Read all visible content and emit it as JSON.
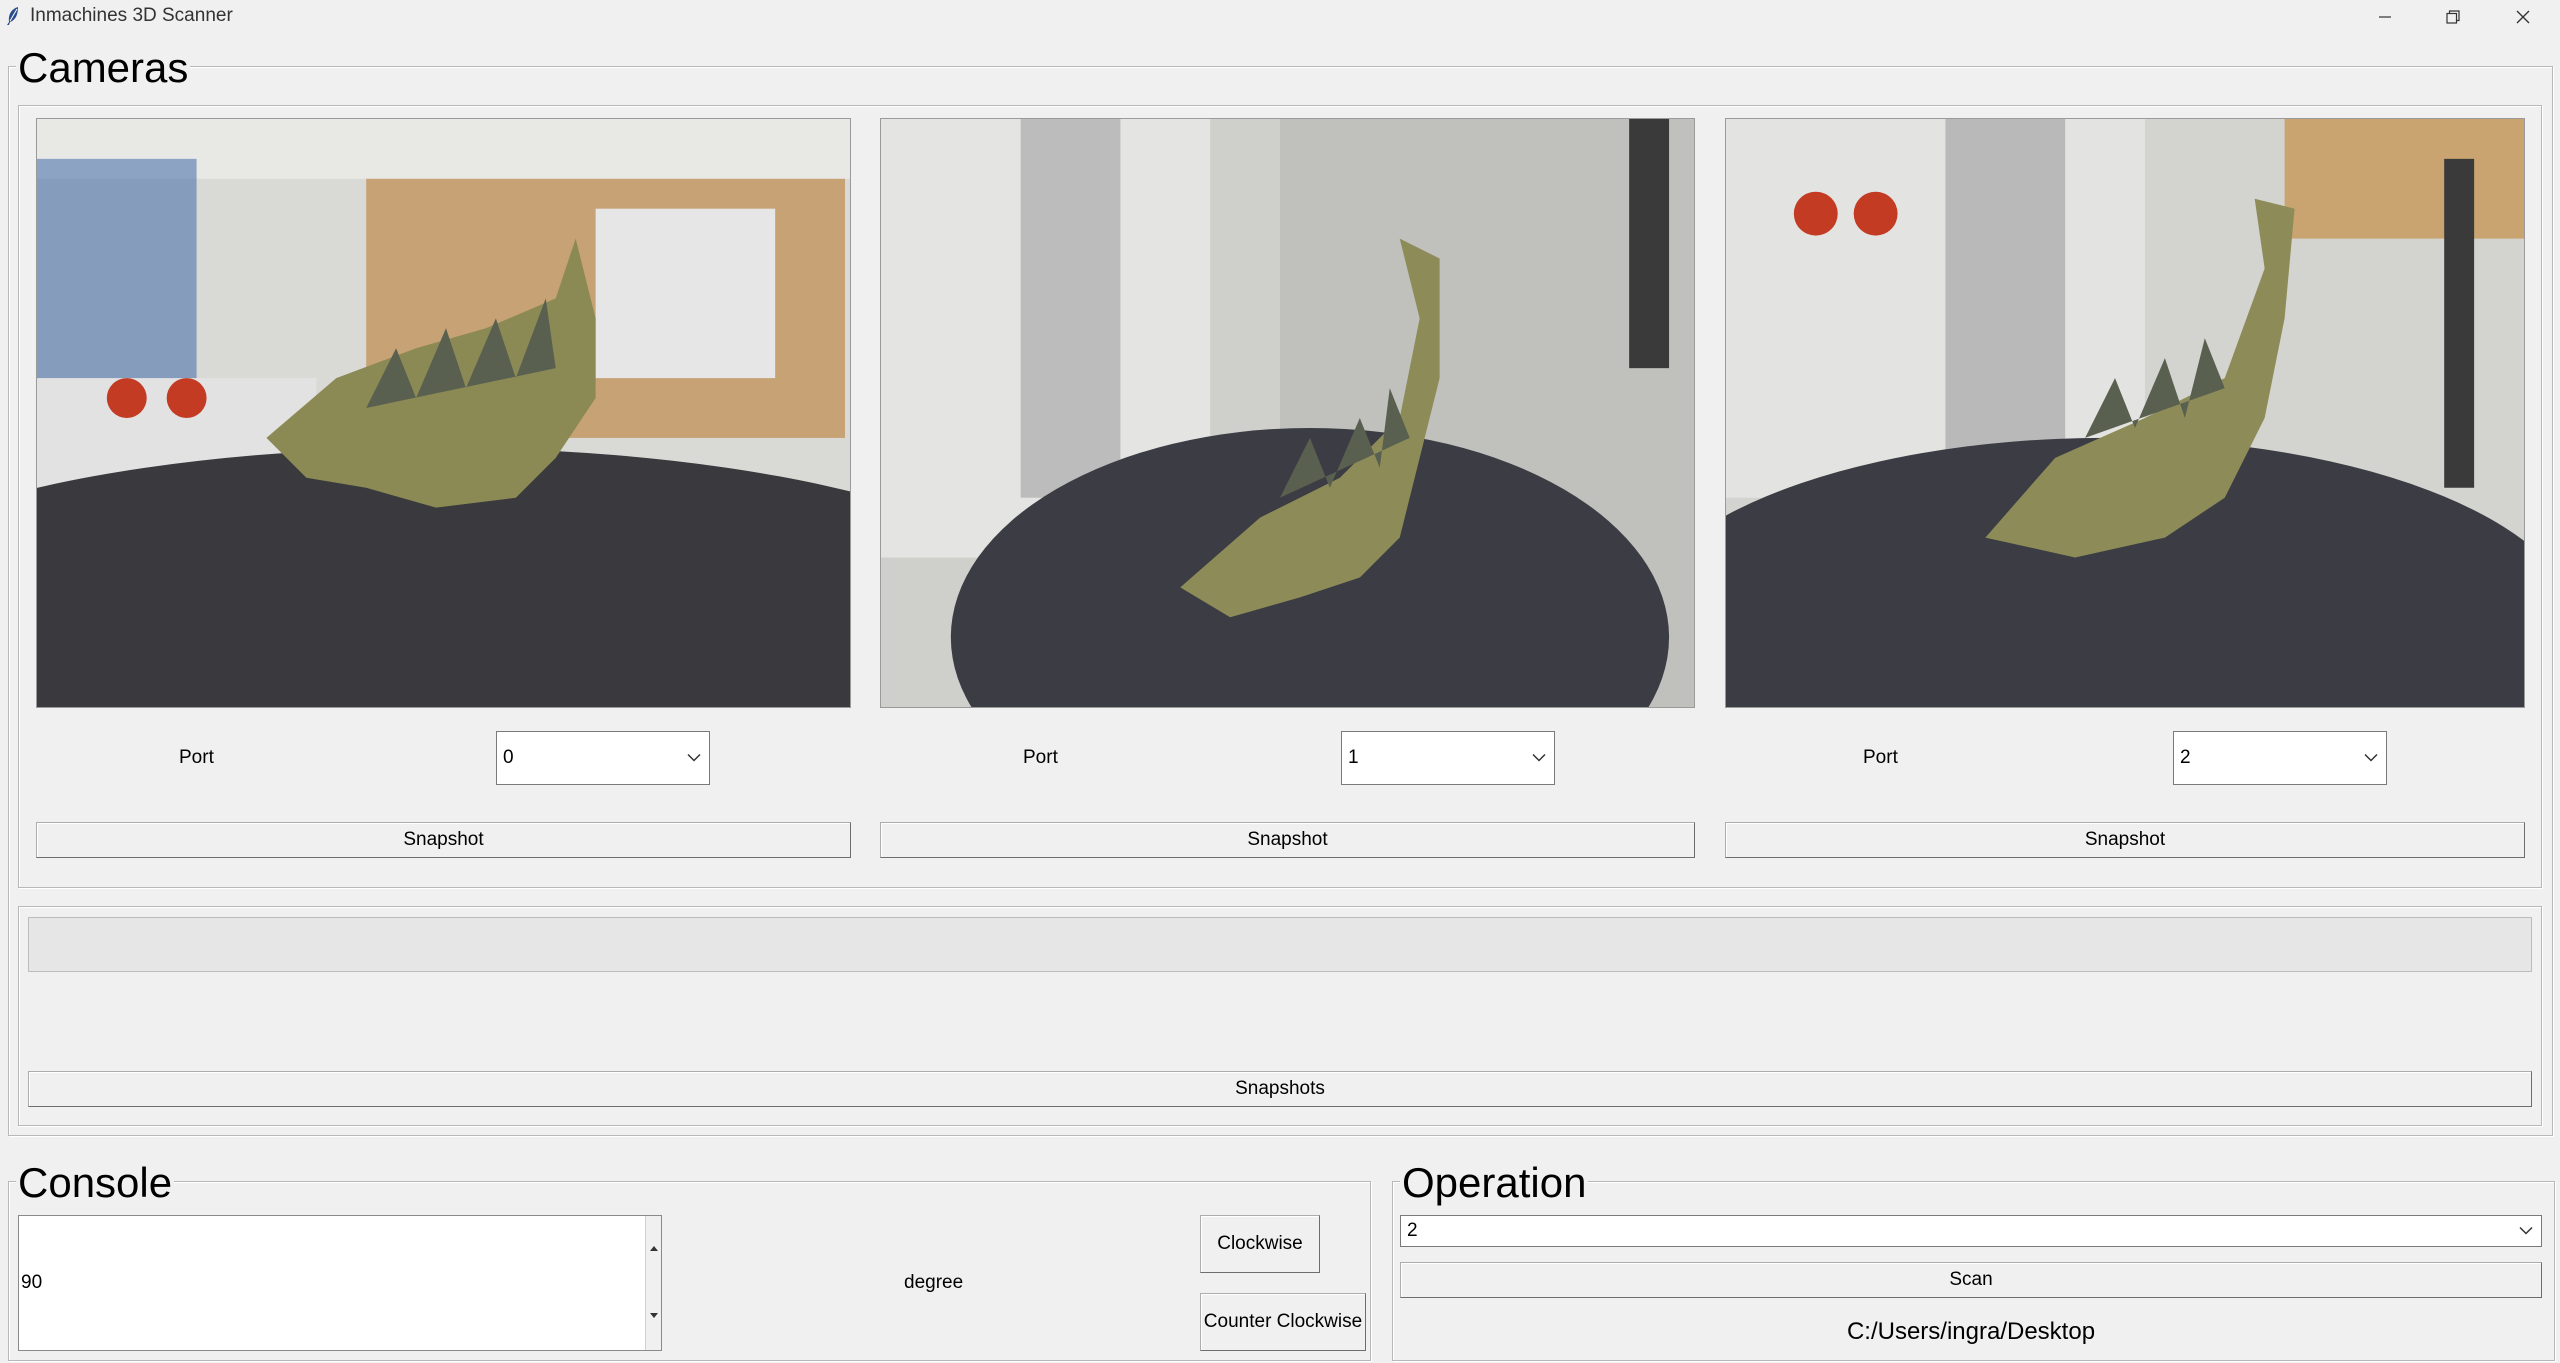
{
  "window": {
    "title": "Inmachines 3D Scanner"
  },
  "cameras": {
    "legend": "Cameras",
    "items": [
      {
        "port_label": "Port",
        "port_value": "0",
        "snapshot_label": "Snapshot"
      },
      {
        "port_label": "Port",
        "port_value": "1",
        "snapshot_label": "Snapshot"
      },
      {
        "port_label": "Port",
        "port_value": "2",
        "snapshot_label": "Snapshot"
      }
    ]
  },
  "progress": {
    "value_percent": 0
  },
  "snapshots_label": "Snapshots",
  "console": {
    "legend": "Console",
    "value": "90",
    "unit_label": "degree",
    "clockwise_label": "Clockwise",
    "counter_clockwise_label": "Counter Clockwise"
  },
  "operation": {
    "legend": "Operation",
    "selected": "2",
    "scan_label": "Scan",
    "path": "C:/Users/ingra/Desktop"
  },
  "icons": {
    "app": "feather-icon",
    "minimize": "minimize-icon",
    "restore": "restore-icon",
    "close": "close-icon",
    "dropdown": "chevron-down-icon"
  }
}
